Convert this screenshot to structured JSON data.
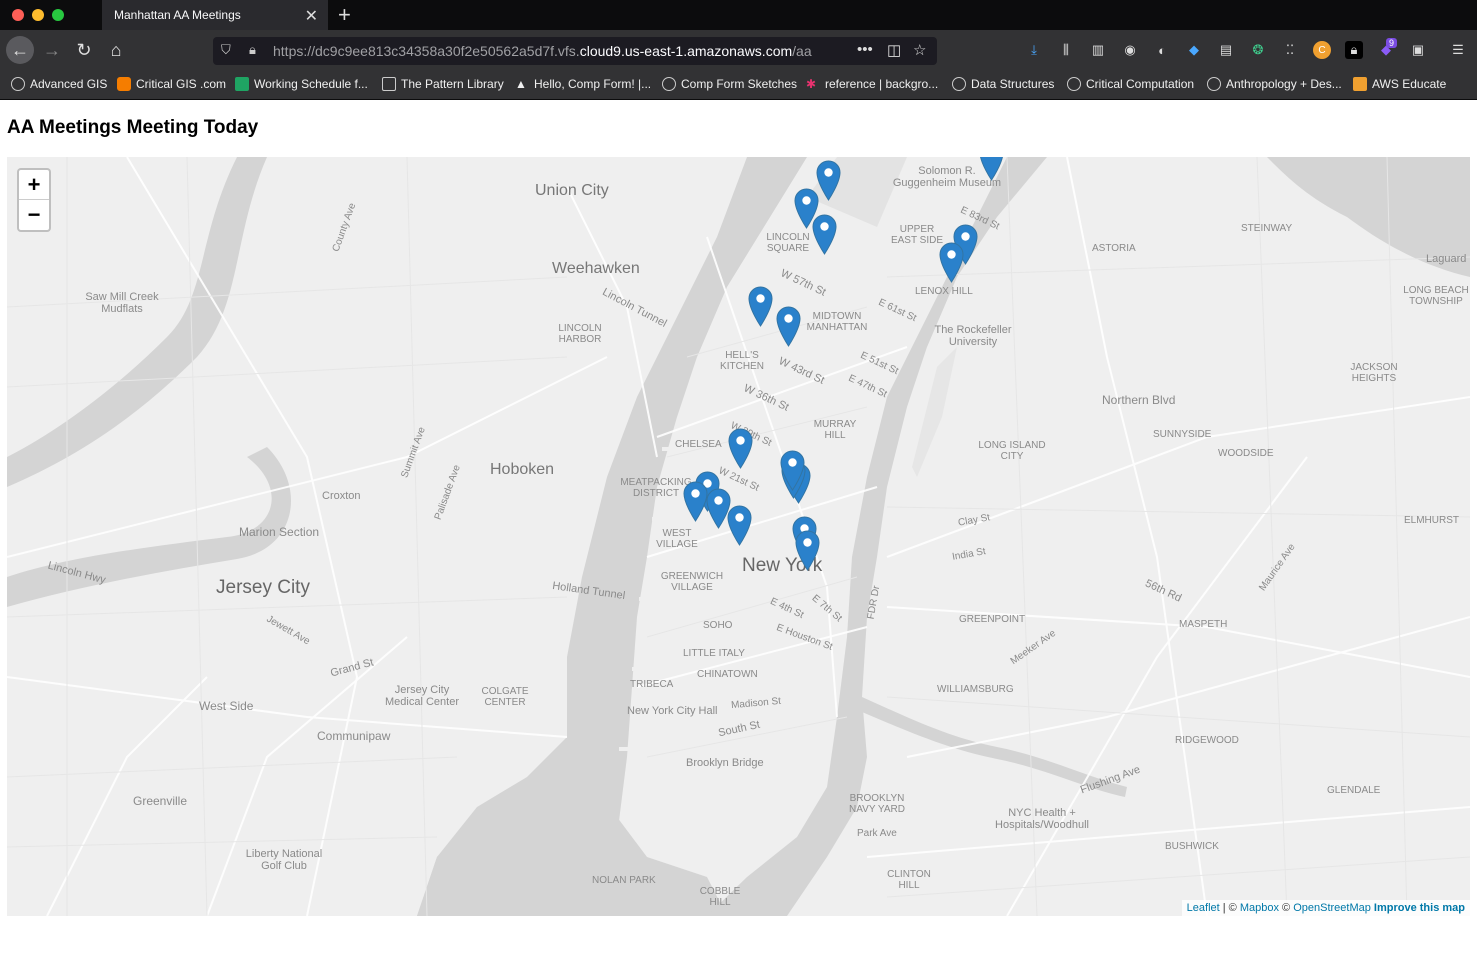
{
  "browser": {
    "tab_title": "Manhattan AA Meetings",
    "url_prefix": "https://dc9c9ee813c34358a30f2e50562a5d7f.vfs.",
    "url_host": "cloud9.us-east-1.amazonaws.com",
    "url_suffix": "/aa",
    "bookmarks": [
      "Advanced GIS",
      "Critical GIS .com",
      "Working Schedule f...",
      "The Pattern Library",
      "Hello, Comp Form! |...",
      "Comp Form Sketches",
      "reference | backgro...",
      "Data Structures",
      "Critical Computation",
      "Anthropology + Des...",
      "AWS Educate"
    ],
    "extension_badge": "9"
  },
  "page": {
    "title": "AA Meetings Meeting Today"
  },
  "map": {
    "zoom_in": "+",
    "zoom_out": "−",
    "attribution": {
      "leaflet": "Leaflet",
      "sep1": " | © ",
      "mapbox": "Mapbox",
      "sep2": " © ",
      "osm": "OpenStreetMap",
      "improve": "Improve this map"
    },
    "labels": {
      "union_city": "Union City",
      "weehawken": "Weehawken",
      "hoboken": "Hoboken",
      "jersey_city": "Jersey City",
      "new_york": "New York",
      "marion_section": "Marion Section",
      "west_side": "West Side",
      "communipaw": "Communipaw",
      "greenville": "Greenville",
      "liberty_golf": "Liberty National Golf Club",
      "jc_medical": "Jersey City Medical Center",
      "colgate": "COLGATE CENTER",
      "croxton": "Croxton",
      "saw_mill": "Saw Mill Creek Mudflats",
      "lincoln_harbor": "LINCOLN HARBOR",
      "hells_kitchen": "HELL'S KITCHEN",
      "midtown": "MIDTOWN MANHATTAN",
      "lincoln_square": "LINCOLN SQUARE",
      "upper_east": "UPPER EAST SIDE",
      "lenox_hill": "LENOX HILL",
      "guggenheim": "Solomon R. Guggenheim Museum",
      "rockefeller": "The Rockefeller University",
      "murray_hill": "MURRAY HILL",
      "chelsea": "CHELSEA",
      "meatpacking": "MEATPACKING DISTRICT",
      "west_village": "WEST VILLAGE",
      "greenwich": "GREENWICH VILLAGE",
      "soho": "SOHO",
      "little_italy": "LITTLE ITALY",
      "chinatown": "CHINATOWN",
      "tribeca": "TRIBECA",
      "city_hall": "New York City Hall",
      "brooklyn_bridge": "Brooklyn Bridge",
      "astoria": "ASTORIA",
      "steinway": "STEINWAY",
      "laguardia": "Laguard",
      "long_beach": "LONG BEACH TOWNSHIP",
      "jackson_heights": "JACKSON HEIGHTS",
      "lic": "LONG ISLAND CITY",
      "sunnyside": "SUNNYSIDE",
      "woodside": "WOODSIDE",
      "elmhurst": "ELMHURST",
      "greenpoint": "GREENPOINT",
      "maspeth": "MASPETH",
      "williamsburg": "WILLIAMSBURG",
      "ridgewood": "RIDGEWOOD",
      "glendale": "GLENDALE",
      "bushwick": "BUSHWICK",
      "brooklyn_navy": "BROOKLYN NAVY YARD",
      "nyc_health": "NYC Health + Hospitals/Woodhull",
      "clinton_hill": "CLINTON HILL",
      "cobble_hill": "COBBLE HILL",
      "nolan_park": "NOLAN PARK",
      "northern_blvd": "Northern Blvd",
      "holland_tunnel": "Holland Tunnel",
      "lincoln_tunnel": "Lincoln Tunnel",
      "lincoln_hwy": "Lincoln Hwy",
      "south_st": "South St",
      "fdr": "FDR Dr",
      "w57": "W 57th St",
      "w43": "W 43rd St",
      "w36": "W 36th St",
      "e51": "E 51st St",
      "e47": "E 47th St",
      "e61": "E 61st St",
      "e83": "E 83rd St",
      "w29": "W 29th St",
      "w21": "W 21st St",
      "e4": "E 4th St",
      "e7": "E 7th St",
      "e_houston": "E Houston St",
      "madison": "Madison St",
      "park_ave": "Park Ave",
      "flushing": "Flushing Ave",
      "grand_st": "Grand St",
      "jewett": "Jewett Ave",
      "summit": "Summit Ave",
      "palisade": "Palisade Ave",
      "county_ave": "County Ave",
      "clay_st": "Clay St",
      "india_st": "India St",
      "meeker": "Meeker Ave",
      "maurice": "Maurice Ave",
      "queens_blvd_56": "56th Rd"
    },
    "markers": [
      "meeting-marker",
      "meeting-marker",
      "meeting-marker",
      "meeting-marker",
      "meeting-marker",
      "meeting-marker",
      "meeting-marker",
      "meeting-marker",
      "meeting-marker",
      "meeting-marker",
      "meeting-marker",
      "meeting-marker",
      "meeting-marker",
      "meeting-marker",
      "meeting-marker",
      "meeting-marker",
      "meeting-marker",
      "meeting-marker"
    ],
    "marker_color": "#2a81cb",
    "water_color": "#d4d4d4",
    "land_color": "#efefef"
  }
}
